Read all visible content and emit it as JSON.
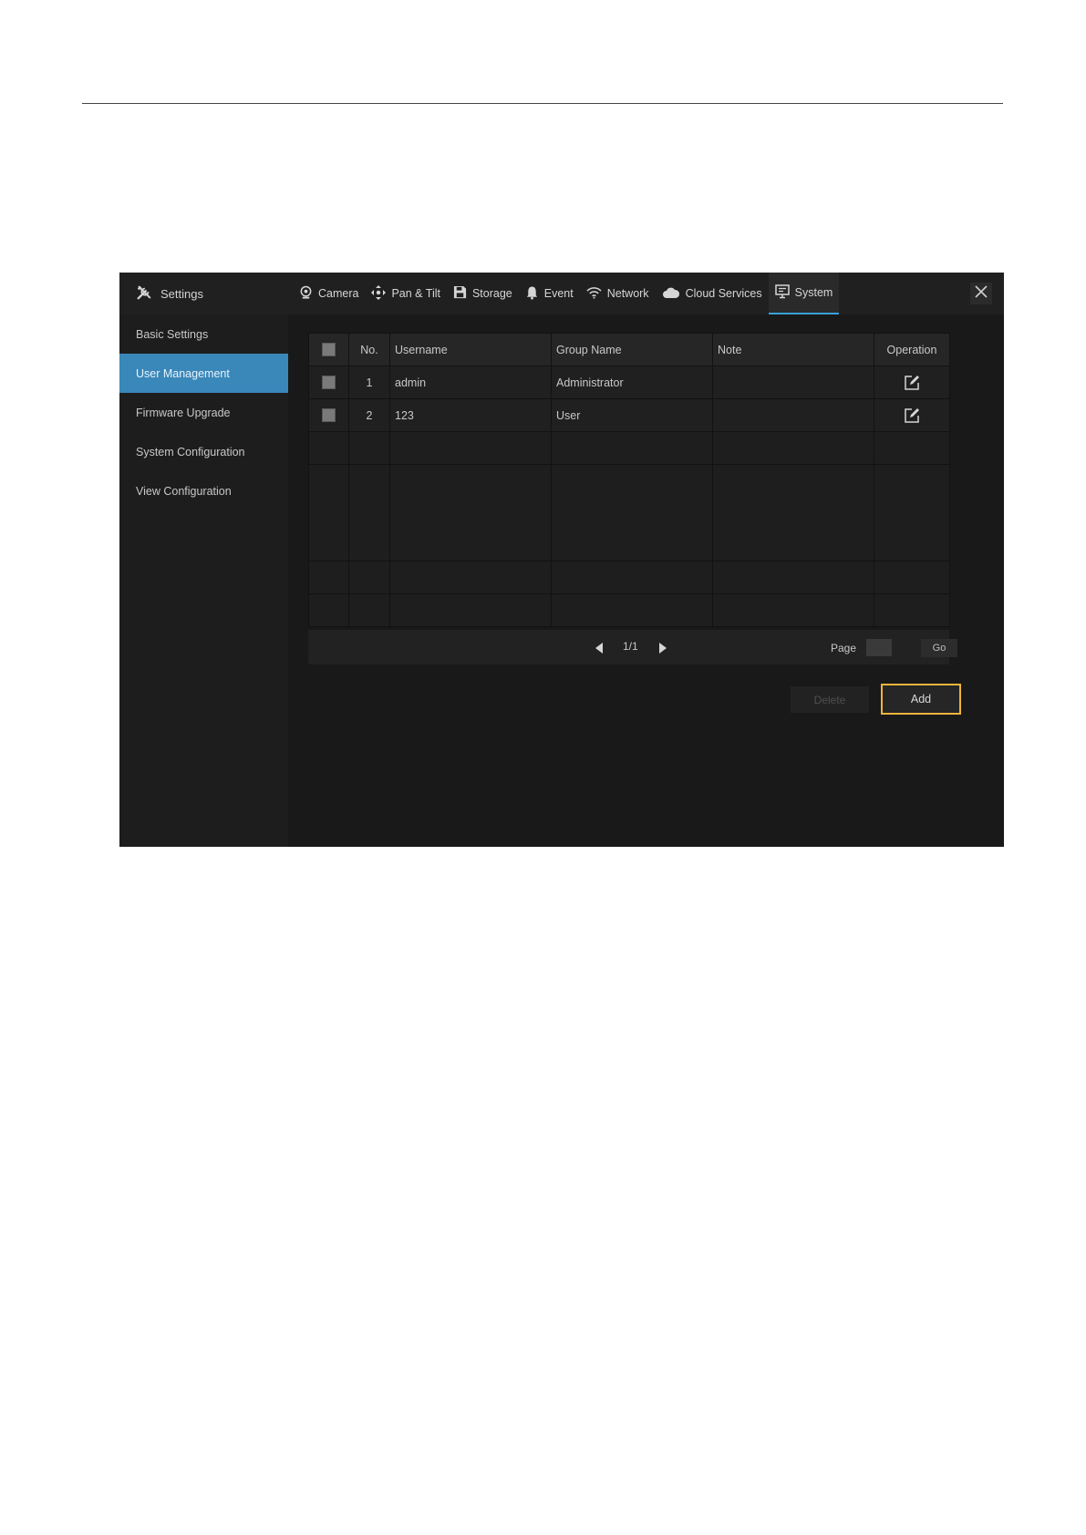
{
  "app": {
    "title": "Settings"
  },
  "tabs": [
    {
      "label": "Camera",
      "icon": "camera-icon"
    },
    {
      "label": "Pan & Tilt",
      "icon": "pan-tilt-icon"
    },
    {
      "label": "Storage",
      "icon": "storage-icon"
    },
    {
      "label": "Event",
      "icon": "bell-icon"
    },
    {
      "label": "Network",
      "icon": "wifi-icon"
    },
    {
      "label": "Cloud Services",
      "icon": "cloud-icon"
    },
    {
      "label": "System",
      "icon": "monitor-icon",
      "active": true
    }
  ],
  "sidebar": {
    "items": [
      {
        "label": "Basic Settings"
      },
      {
        "label": "User Management",
        "active": true
      },
      {
        "label": "Firmware Upgrade"
      },
      {
        "label": "System Configuration"
      },
      {
        "label": "View Configuration"
      }
    ]
  },
  "table": {
    "headers": {
      "no": "No.",
      "username": "Username",
      "group": "Group Name",
      "note": "Note",
      "operation": "Operation"
    },
    "rows": [
      {
        "no": "1",
        "username": "admin",
        "group": "Administrator",
        "note": ""
      },
      {
        "no": "2",
        "username": "123",
        "group": "User",
        "note": ""
      }
    ]
  },
  "pager": {
    "count": "1/1",
    "page_label": "Page",
    "page_value": "",
    "go_label": "Go"
  },
  "actions": {
    "delete_label": "Delete",
    "add_label": "Add"
  },
  "colors": {
    "accent": "#3a87b9",
    "tab_underline": "#3aa0d8",
    "highlight": "#f0b43c",
    "background": "#1b1b1b"
  }
}
